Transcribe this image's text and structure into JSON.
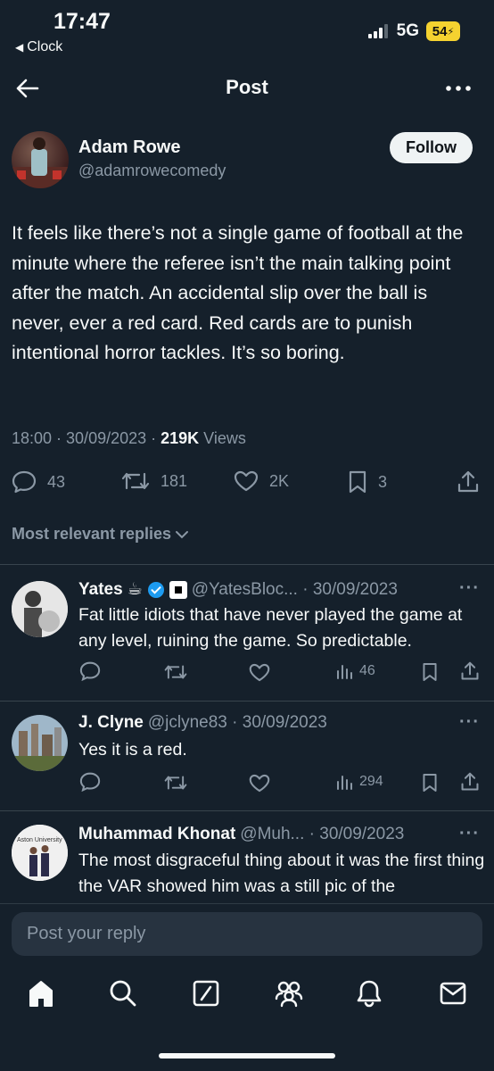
{
  "status_bar": {
    "time": "17:47",
    "back_app": "Clock",
    "network": "5G",
    "battery": "54"
  },
  "header": {
    "title": "Post"
  },
  "post": {
    "author_name": "Adam Rowe",
    "author_handle": "@adamrowecomedy",
    "follow_label": "Follow",
    "text": "It feels like there’s not a single game of football at the minute where the referee isn’t the main talking point after the match. An accidental slip over the ball is never, ever a red card. Red cards are to punish intentional horror tackles. It’s so boring.",
    "time": "18:00 · 30/09/2023 · ",
    "views_count": "219K",
    "views_label": " Views",
    "stats": {
      "replies": "43",
      "reposts": "181",
      "likes": "2K",
      "bookmarks": "3"
    }
  },
  "replies_section": {
    "sort_label": "Most relevant replies"
  },
  "replies": [
    {
      "name": "Yates",
      "emoji": "☕",
      "handle_date": "@YatesBloc... · 30/09/2023",
      "text": "Fat little idiots that have never played the game at any level, ruining the game. So predictable.",
      "views": "46"
    },
    {
      "name": "J. Clyne",
      "handle_date": "@jclyne83 · 30/09/2023",
      "text": "Yes it is a red.",
      "views": "294"
    },
    {
      "name": "Muhammad Khonat",
      "handle_date": "@Muh... · 30/09/2023",
      "text": "The most disgraceful thing about it was the first thing the VAR showed him was a still pic of the",
      "avatar_text": "Aston University"
    }
  ],
  "reply_input": {
    "placeholder": "Post your reply"
  },
  "colors": {
    "background": "#15202b",
    "muted": "#8b98a5",
    "verified": "#1d9bf0",
    "battery": "#f5d230"
  }
}
